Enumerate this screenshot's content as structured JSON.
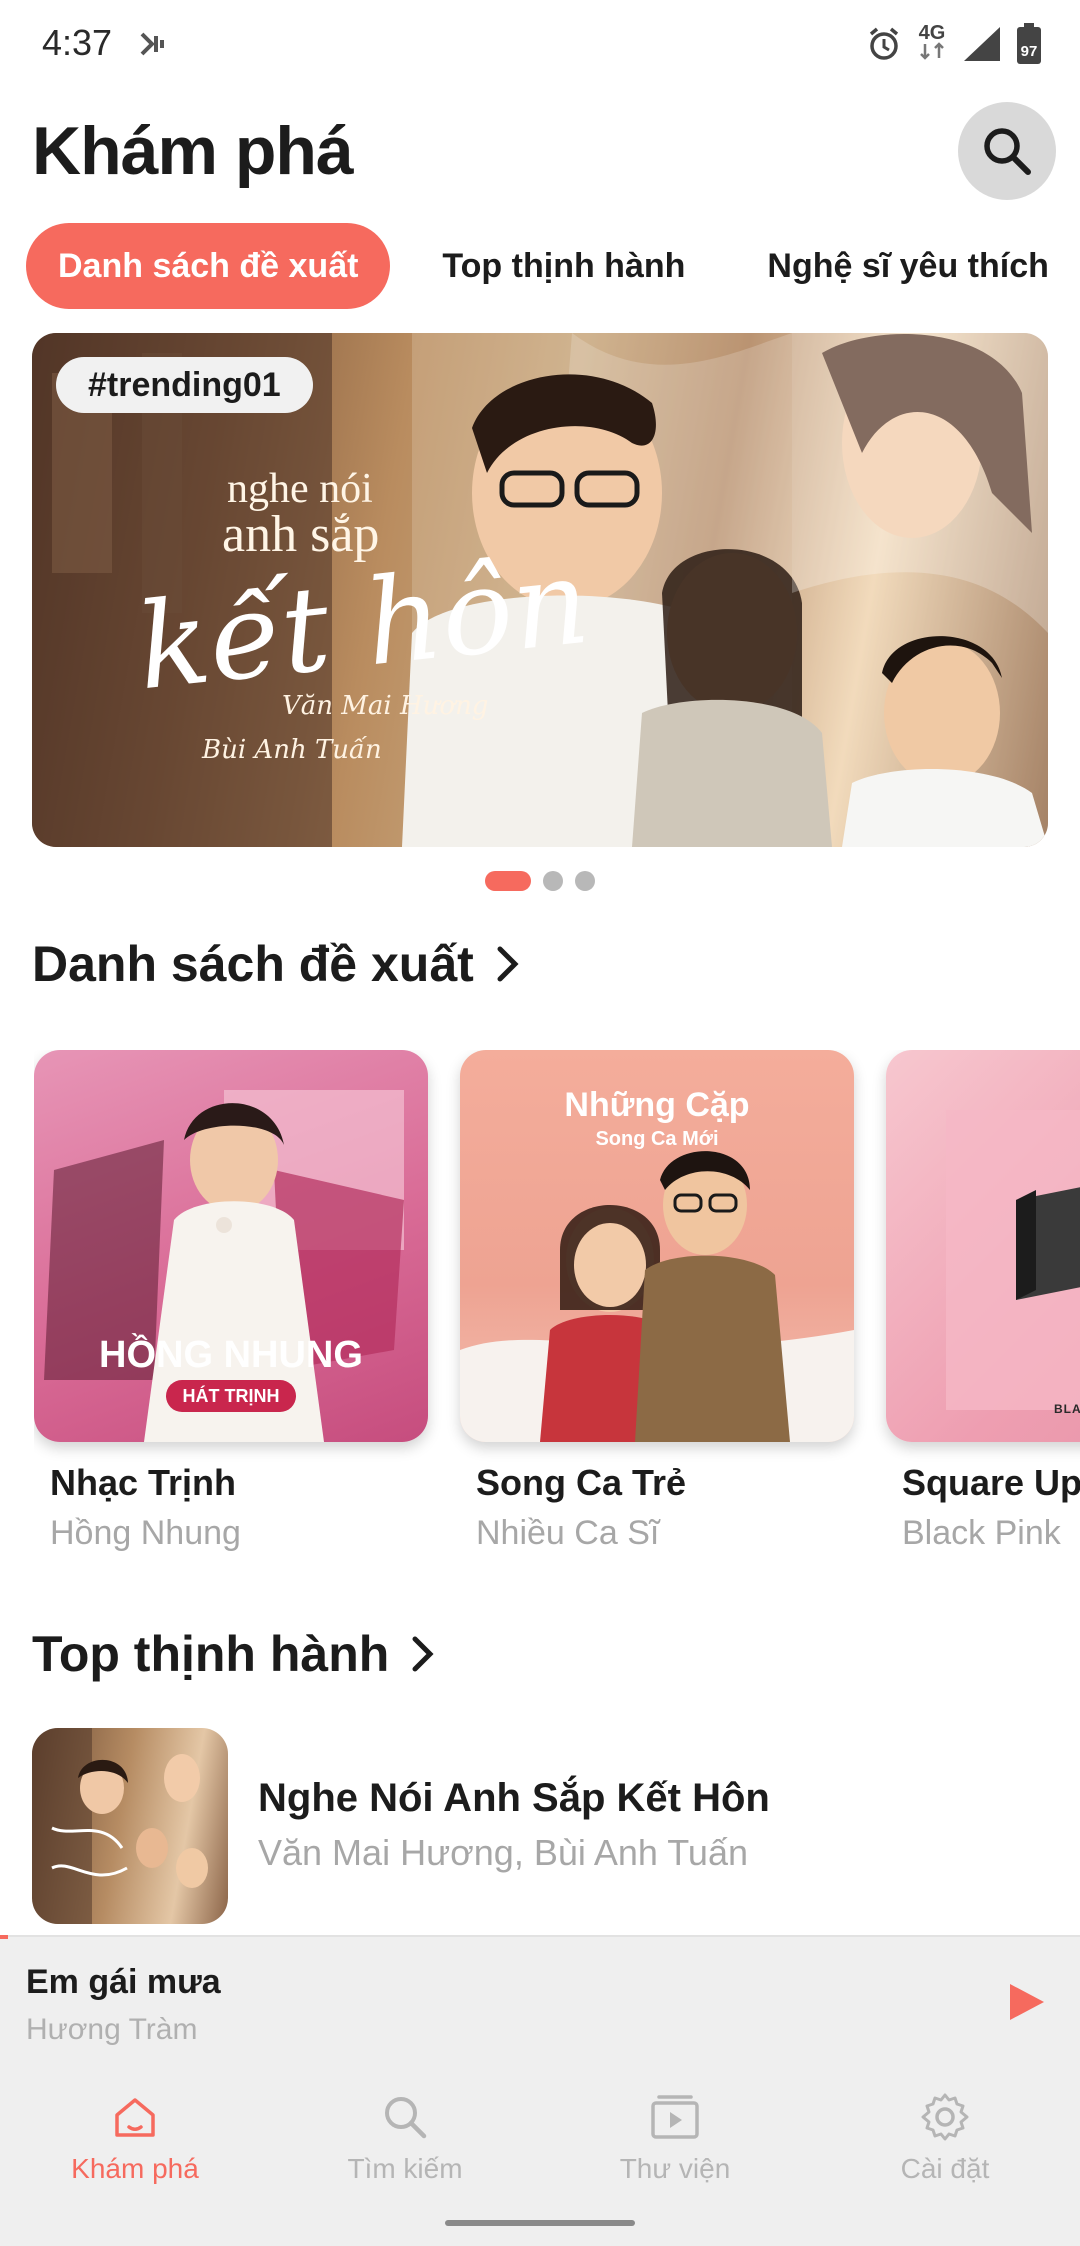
{
  "status_bar": {
    "time": "4:37",
    "network": "4G",
    "battery": "97",
    "icons": [
      "media-cast-icon",
      "alarm-icon",
      "signal-icon",
      "battery-icon"
    ]
  },
  "header": {
    "title": "Khám phá",
    "search_icon": "search-icon"
  },
  "tabs": [
    {
      "label": "Danh sách đề xuất",
      "active": true
    },
    {
      "label": "Top thịnh hành",
      "active": false
    },
    {
      "label": "Nghệ sĩ yêu thích",
      "active": false
    }
  ],
  "banner": {
    "tag": "#trending01",
    "art_line1": "nghe nói",
    "art_line2": "anh sắp",
    "art_line3": "kết hôn",
    "art_credit1": "Văn Mai Hương",
    "art_credit2": "Bùi Anh Tuấn",
    "page_count": 3,
    "current_page": 1
  },
  "section_recommended": {
    "title": "Danh sách đề xuất",
    "cards": [
      {
        "title": "Nhạc Trịnh",
        "subtitle": "Hồng Nhung",
        "art_title": "HỒNG NHUNG",
        "art_subtitle": "HÁT TRỊNH"
      },
      {
        "title": "Song Ca Trẻ",
        "subtitle": "Nhiều Ca Sĩ",
        "art_title": "Những Cặp",
        "art_subtitle": "Song Ca Mới"
      },
      {
        "title": "Square Up",
        "subtitle": "Black Pink",
        "art_title": "BLACK",
        "art_subtitle": ""
      }
    ]
  },
  "section_trending": {
    "title": "Top thịnh hành",
    "tracks": [
      {
        "title": "Nghe Nói Anh Sắp Kết Hôn",
        "artist": "Văn Mai Hương, Bùi Anh Tuấn"
      }
    ]
  },
  "player": {
    "title": "Em gái mưa",
    "artist": "Hương Tràm",
    "state": "paused",
    "accent": "#f66a5e"
  },
  "bottom_nav": [
    {
      "label": "Khám phá",
      "icon": "home-icon",
      "active": true
    },
    {
      "label": "Tìm kiếm",
      "icon": "search-icon",
      "active": false
    },
    {
      "label": "Thư viện",
      "icon": "library-icon",
      "active": false
    },
    {
      "label": "Cài đặt",
      "icon": "gear-icon",
      "active": false
    }
  ],
  "colors": {
    "accent": "#f66a5e",
    "muted_text": "#a7a7a7",
    "nav_background": "#efefef"
  }
}
